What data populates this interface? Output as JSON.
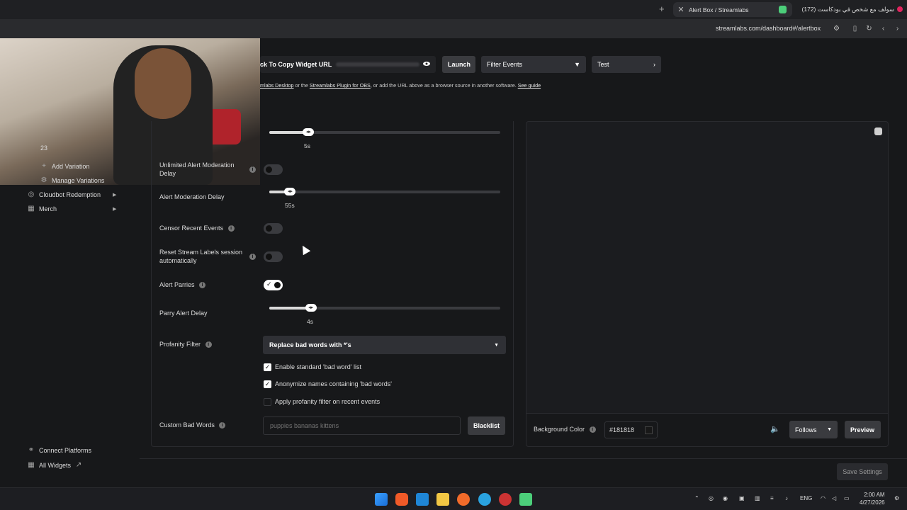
{
  "browser": {
    "tabs": [
      {
        "label": "Alert Box / Streamlabs",
        "active": true
      },
      {
        "label": "(172) سولف مع شخص في بودكاست",
        "active": false
      }
    ],
    "url": "streamlabs.com/dashboard#/alertbox"
  },
  "toolbar": {
    "copy_url_label": "ck To Copy Widget URL",
    "launch_label": "Launch",
    "filter_label": "Filter Events",
    "test_label": "Test"
  },
  "hint": {
    "link1": "mlabs Desktop",
    "mid": " or the ",
    "link2": "Streamlabs Plugin for OBS",
    "tail": ", or add the URL above as a browser source in another software. ",
    "guide": "See guide"
  },
  "sidebar": {
    "partial_number": "23",
    "items": [
      {
        "label": "Add Variation",
        "icon": "plus-icon"
      },
      {
        "label": "Manage Variations",
        "icon": "gear-icon"
      },
      {
        "label": "Cloudbot Redemption",
        "icon": "cloudbot-icon"
      },
      {
        "label": "Merch",
        "icon": "merch-icon"
      }
    ],
    "bottom": [
      {
        "label": "Connect Platforms",
        "icon": "link-icon"
      },
      {
        "label": "All Widgets",
        "icon": "grid-icon"
      }
    ]
  },
  "settings": {
    "top_slider_value": "5s",
    "top_slider_fraction": 0.17,
    "unlimited_delay_label": "Unlimited Alert Moderation Delay",
    "unlimited_delay_on": false,
    "moderation_delay_label": "Alert Moderation Delay",
    "moderation_delay_value": "55s",
    "moderation_delay_fraction": 0.09,
    "censor_label": "Censor Recent Events",
    "censor_on": false,
    "reset_labels_label": "Reset Stream Labels session automatically",
    "reset_labels_on": false,
    "parries_label": "Alert Parries",
    "parries_on": true,
    "parry_delay_label": "Parry Alert Delay",
    "parry_delay_value": "4s",
    "parry_delay_fraction": 0.18,
    "profanity_label": "Profanity Filter",
    "profanity_selected": "Replace bad words with *'s",
    "checkboxes": [
      {
        "label": "Enable standard 'bad word' list",
        "checked": true
      },
      {
        "label": "Anonymize names containing 'bad words'",
        "checked": true
      },
      {
        "label": "Apply profanity filter on recent events",
        "checked": false
      }
    ],
    "custom_words_label": "Custom Bad Words",
    "custom_words_placeholder": "puppies bananas kittens",
    "blacklist_label": "Blacklist"
  },
  "preview": {
    "bg_color_label": "Background Color",
    "bg_color_value": "#181818",
    "event_select": "Follows",
    "preview_label": "Preview"
  },
  "footer": {
    "save_label": "Save Settings"
  },
  "taskbar": {
    "lang": "ENG",
    "time": "2:00 AM",
    "date": "4/27/2026"
  }
}
